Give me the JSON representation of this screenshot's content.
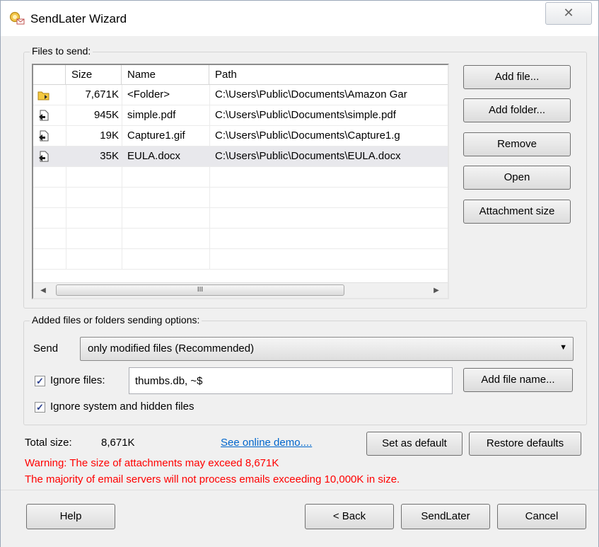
{
  "window": {
    "title": "SendLater Wizard",
    "close_glyph": "✕"
  },
  "files_group": {
    "label": "Files to send:",
    "columns": [
      "",
      "Size",
      "Name",
      "Path"
    ],
    "rows": [
      {
        "icon": "folder-icon",
        "size": "7,671K",
        "name": "<Folder>",
        "path": "C:\\Users\\Public\\Documents\\Amazon Gar"
      },
      {
        "icon": "file-icon",
        "size": "945K",
        "name": "simple.pdf",
        "path": "C:\\Users\\Public\\Documents\\simple.pdf"
      },
      {
        "icon": "file-icon",
        "size": "19K",
        "name": "Capture1.gif",
        "path": "C:\\Users\\Public\\Documents\\Capture1.g"
      },
      {
        "icon": "file-icon",
        "size": "35K",
        "name": "EULA.docx",
        "path": "C:\\Users\\Public\\Documents\\EULA.docx"
      }
    ],
    "scroll_left": "◀",
    "scroll_right": "▶",
    "scroll_grip": "III"
  },
  "side_buttons": {
    "add_file": "Add file...",
    "add_folder": "Add folder...",
    "remove": "Remove",
    "open": "Open",
    "attachment_size": "Attachment size"
  },
  "options": {
    "label": "Added files or folders sending options:",
    "send_label": "Send",
    "send_value": "only modified files (Recommended)",
    "ignore_files_label": "Ignore files:",
    "ignore_files_value": "thumbs.db, ~$",
    "ignore_files_checked": true,
    "add_file_name": "Add file name...",
    "ignore_system_label": "Ignore system and hidden files",
    "ignore_system_checked": true
  },
  "summary": {
    "total_label": "Total size:",
    "total_value": "8,671K",
    "demo_link": "See online demo....",
    "set_default": "Set as default",
    "restore_defaults": "Restore defaults",
    "warning1": "Warning: The size of attachments may exceed 8,671K",
    "warning2": "The majority of email servers will not process emails exceeding 10,000K in size."
  },
  "footer": {
    "help": "Help",
    "back": "< Back",
    "sendlater": "SendLater",
    "cancel": "Cancel"
  }
}
